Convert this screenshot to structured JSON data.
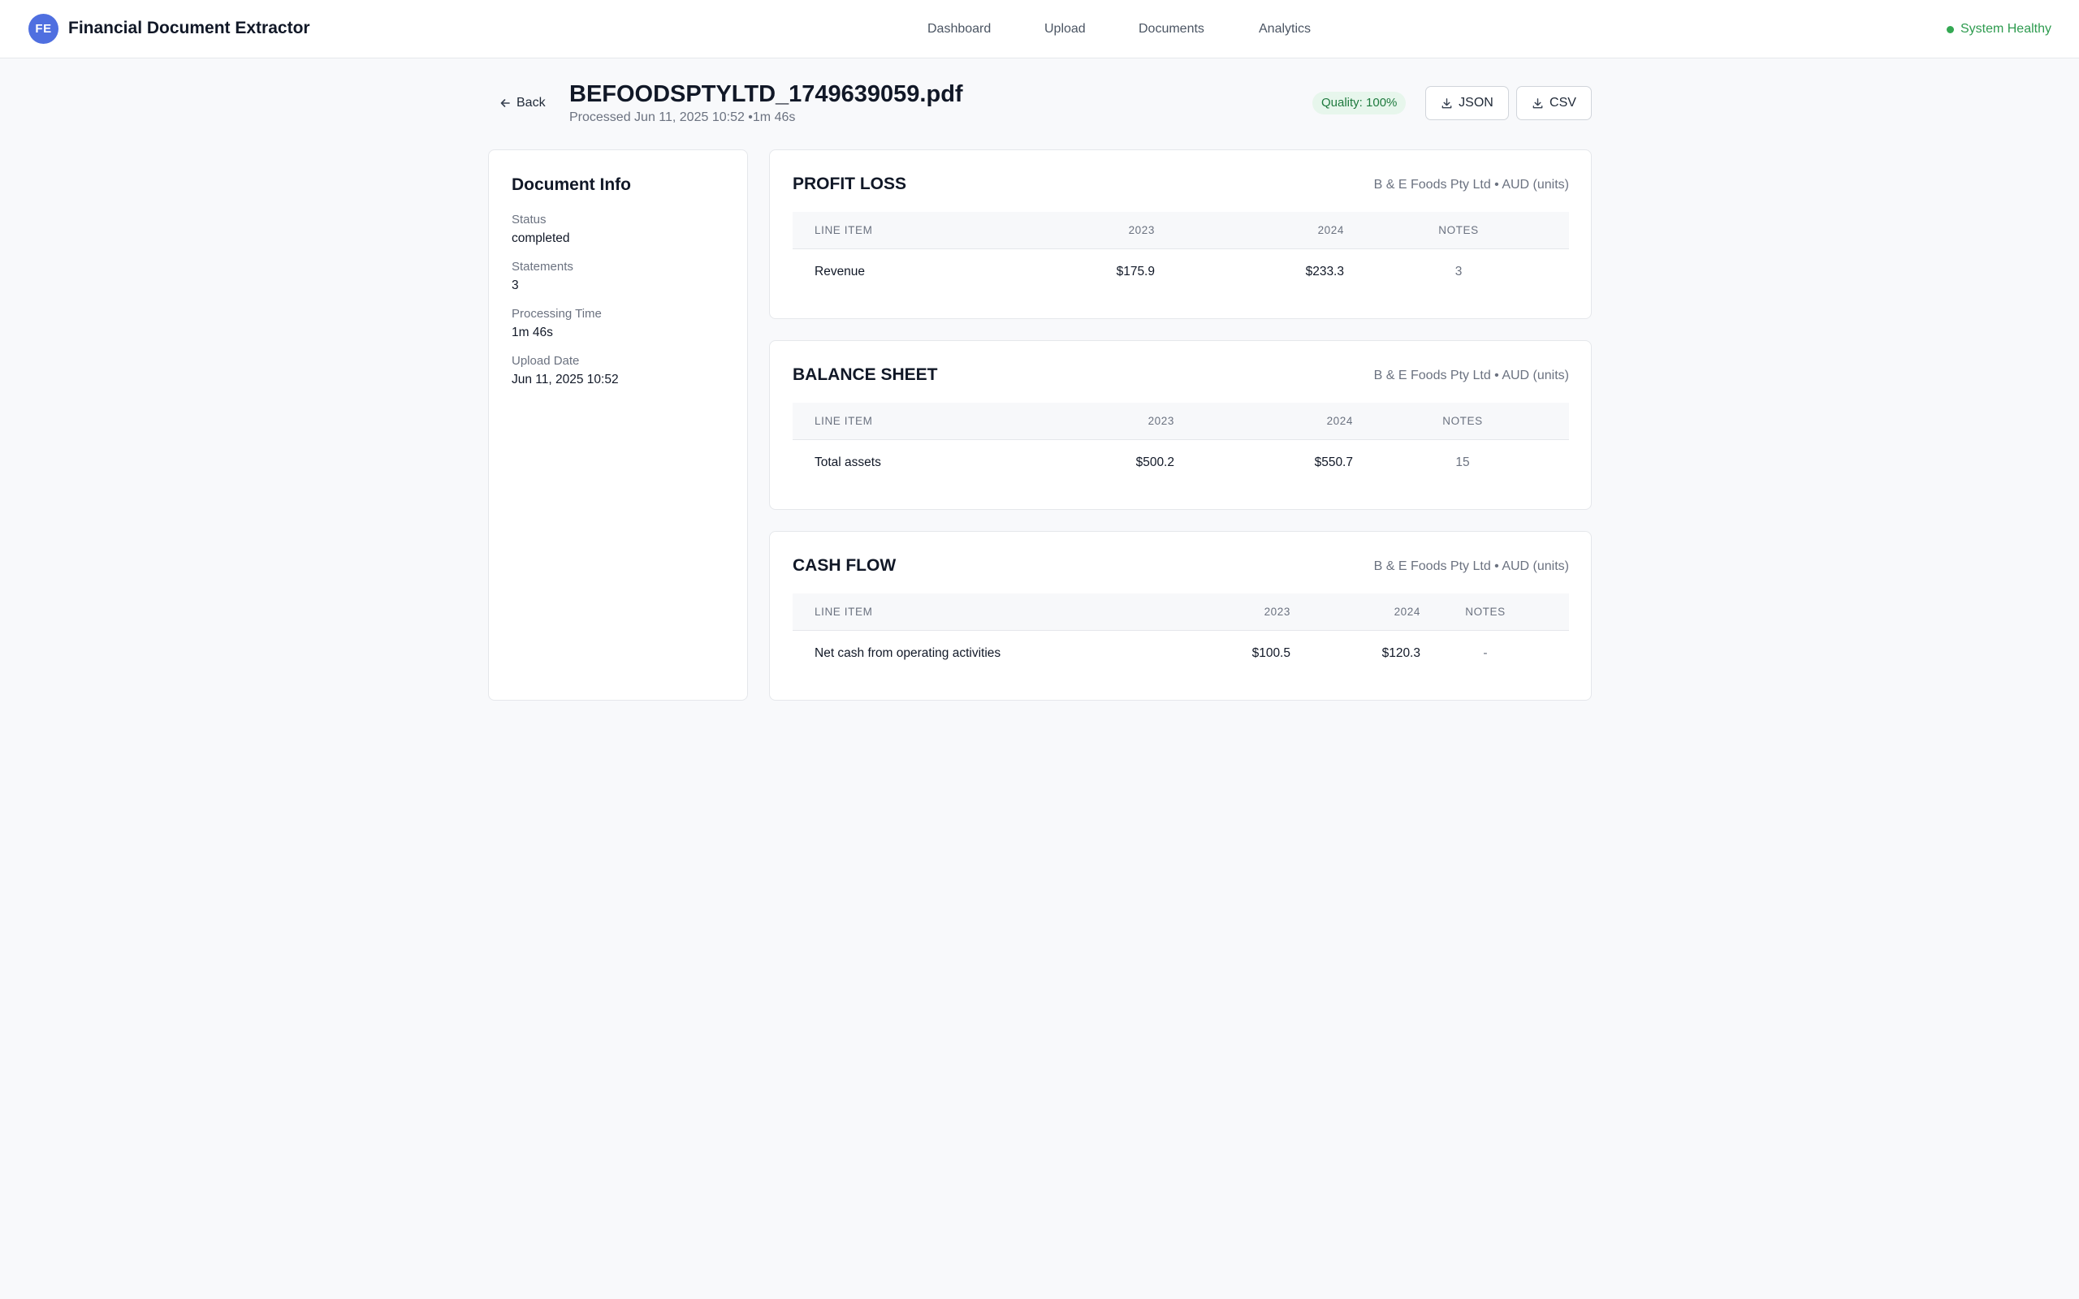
{
  "app": {
    "logo_initials": "FE",
    "title": "Financial Document Extractor"
  },
  "nav": {
    "dashboard": "Dashboard",
    "upload": "Upload",
    "documents": "Documents",
    "analytics": "Analytics"
  },
  "system_status": {
    "label": "System Healthy",
    "color": "#34a853"
  },
  "header": {
    "back_label": "Back",
    "filename": "BEFOODSPTYLTD_1749639059.pdf",
    "subtitle": "Processed Jun 11, 2025 10:52 •1m 46s",
    "quality_badge": "Quality: 100%",
    "download_json": "JSON",
    "download_csv": "CSV"
  },
  "document_info": {
    "title": "Document Info",
    "status_label": "Status",
    "status_value": "completed",
    "statements_label": "Statements",
    "statements_value": "3",
    "processing_time_label": "Processing Time",
    "processing_time_value": "1m 46s",
    "upload_date_label": "Upload Date",
    "upload_date_value": "Jun 11, 2025 10:52"
  },
  "statements": [
    {
      "title": "PROFIT LOSS",
      "meta": "B & E Foods Pty Ltd • AUD (units)",
      "columns": [
        "LINE ITEM",
        "2023",
        "2024",
        "NOTES"
      ],
      "rows": [
        {
          "item": "Revenue",
          "y2023": "$175.9",
          "y2024": "$233.3",
          "notes": "3"
        }
      ]
    },
    {
      "title": "BALANCE SHEET",
      "meta": "B & E Foods Pty Ltd • AUD (units)",
      "columns": [
        "LINE ITEM",
        "2023",
        "2024",
        "NOTES"
      ],
      "rows": [
        {
          "item": "Total assets",
          "y2023": "$500.2",
          "y2024": "$550.7",
          "notes": "15"
        }
      ]
    },
    {
      "title": "CASH FLOW",
      "meta": "B & E Foods Pty Ltd • AUD (units)",
      "columns": [
        "LINE ITEM",
        "2023",
        "2024",
        "NOTES"
      ],
      "rows": [
        {
          "item": "Net cash from operating activities",
          "y2023": "$100.5",
          "y2024": "$120.3",
          "notes": "-"
        }
      ]
    }
  ],
  "colors": {
    "accent": "#4f6fe0",
    "success": "#34a853",
    "quality_bg": "#e7f6ec",
    "page_bg": "#f8f9fb"
  }
}
